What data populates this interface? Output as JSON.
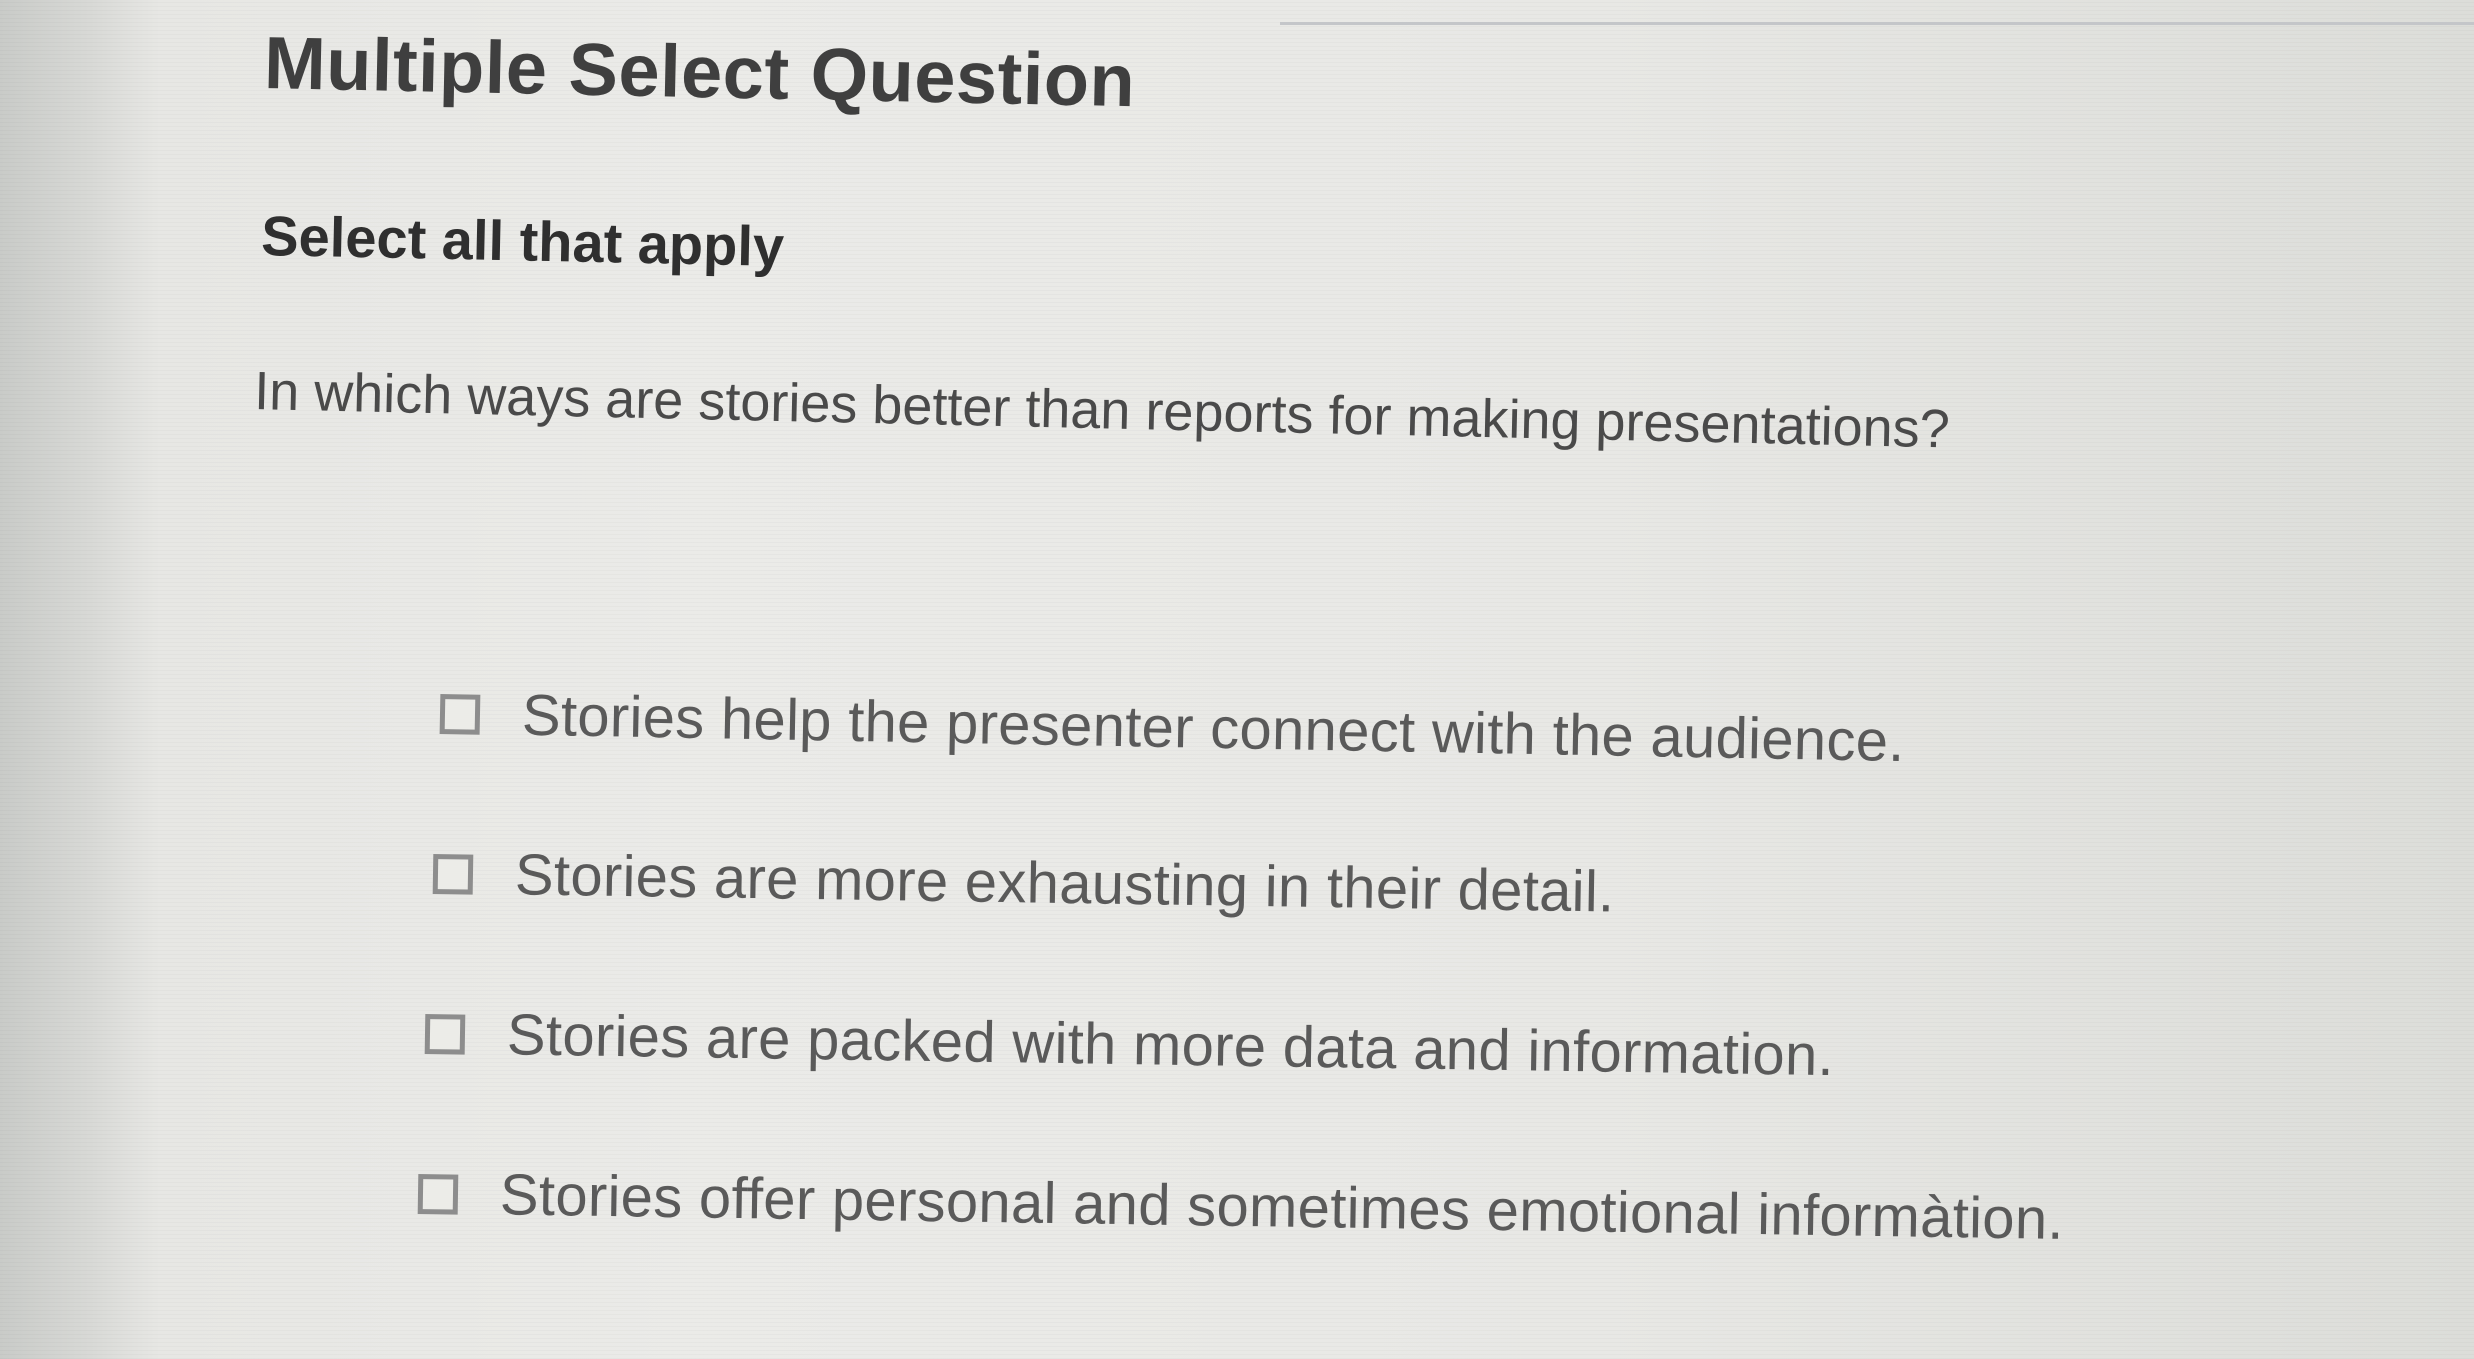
{
  "question": {
    "type_label": "Multiple Select Question",
    "instruction": "Select all that apply",
    "prompt": "In which ways are stories better than reports for making presentations?"
  },
  "options": [
    {
      "label": "Stories help the presenter connect with the audience.",
      "checked": false
    },
    {
      "label": "Stories are more exhausting in their detail.",
      "checked": false
    },
    {
      "label": "Stories are packed with more data and information.",
      "checked": false
    },
    {
      "label": "Stories offer personal and sometimes emotional informàtion.",
      "checked": false
    }
  ]
}
